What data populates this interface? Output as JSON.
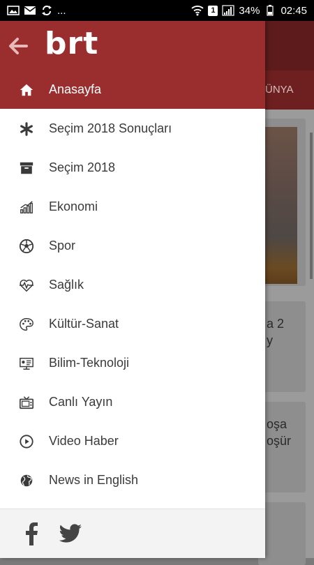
{
  "status_bar": {
    "dots": "...",
    "notification_badge": "1",
    "battery": "34%",
    "time": "02:45",
    "left_icons": [
      "image-icon",
      "mail-icon",
      "sync-icon"
    ],
    "right_icons": [
      "wifi-icon",
      "signal-icon",
      "battery-icon"
    ]
  },
  "drawer": {
    "logo": "brt",
    "back_icon": "arrow-left-icon",
    "items": [
      {
        "label": "Anasayfa",
        "icon": "home-icon",
        "active": true
      },
      {
        "label": "Seçim 2018 Sonuçları",
        "icon": "asterisk-icon",
        "active": false
      },
      {
        "label": "Seçim 2018",
        "icon": "archive-box-icon",
        "active": false
      },
      {
        "label": "Ekonomi",
        "icon": "chart-bars-icon",
        "active": false
      },
      {
        "label": "Spor",
        "icon": "soccer-ball-icon",
        "active": false
      },
      {
        "label": "Sağlık",
        "icon": "heartbeat-icon",
        "active": false
      },
      {
        "label": "Kültür-Sanat",
        "icon": "palette-icon",
        "active": false
      },
      {
        "label": "Bilim-Teknoloji",
        "icon": "presentation-icon",
        "active": false
      },
      {
        "label": "Canlı Yayın",
        "icon": "tv-icon",
        "active": false
      },
      {
        "label": "Video Haber",
        "icon": "play-circle-icon",
        "active": false
      },
      {
        "label": "News in English",
        "icon": "globe-icon",
        "active": false
      }
    ],
    "footer": {
      "icons": [
        "facebook-icon",
        "twitter-icon"
      ]
    }
  },
  "background": {
    "tab_label": "ÜNYA",
    "card_texts": [
      "a 2\ny",
      "oşa\noşür"
    ]
  },
  "colors": {
    "brand": "#9a2d2e",
    "drawer_bg": "#ffffff",
    "text": "#3a3a3a"
  }
}
